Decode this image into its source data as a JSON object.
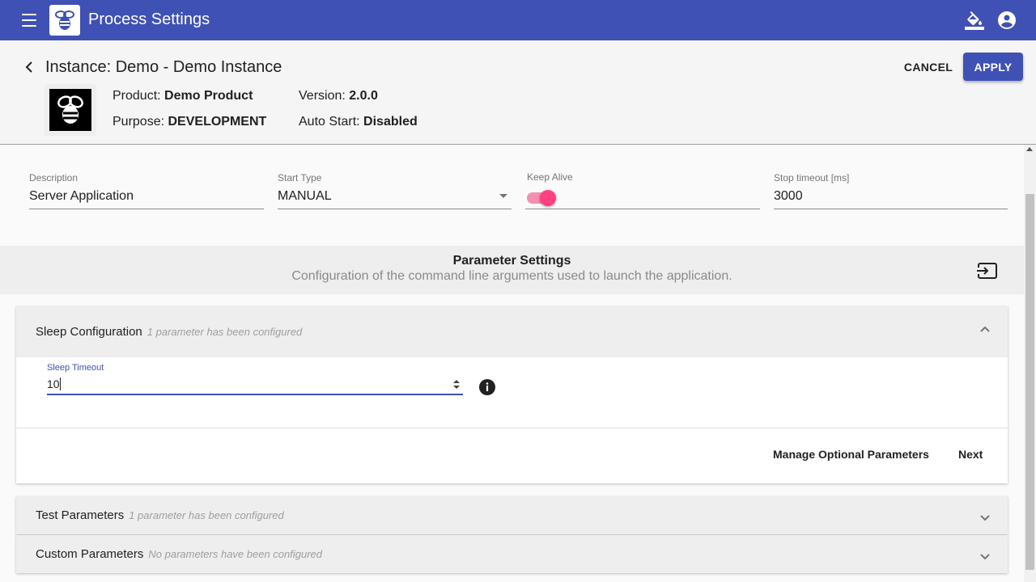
{
  "app": {
    "title": "Process Settings"
  },
  "header": {
    "instance_title": "Instance: Demo - Demo Instance",
    "cancel_label": "CANCEL",
    "apply_label": "APPLY",
    "product_label": "Product:",
    "product_value": "Demo Product",
    "purpose_label": "Purpose:",
    "purpose_value": "DEVELOPMENT",
    "version_label": "Version:",
    "version_value": "2.0.0",
    "autostart_label": "Auto Start:",
    "autostart_value": "Disabled"
  },
  "form": {
    "description_label": "Description",
    "description_value": "Server Application",
    "start_type_label": "Start Type",
    "start_type_value": "MANUAL",
    "keep_alive_label": "Keep Alive",
    "keep_alive_on": true,
    "stop_timeout_label": "Stop timeout [ms]",
    "stop_timeout_value": "3000"
  },
  "parameters": {
    "title": "Parameter Settings",
    "subtitle": "Configuration of the command line arguments used to launch the application.",
    "groups": [
      {
        "name": "Sleep Configuration",
        "note": "1 parameter has been configured",
        "expanded": true
      },
      {
        "name": "Test Parameters",
        "note": "1 parameter has been configured",
        "expanded": false
      },
      {
        "name": "Custom Parameters",
        "note": "No parameters have been configured",
        "expanded": false
      }
    ],
    "sleep_timeout_label": "Sleep Timeout",
    "sleep_timeout_value": "10",
    "manage_label": "Manage Optional Parameters",
    "next_label": "Next"
  },
  "colors": {
    "primary": "#3f51b5",
    "accent": "#ff4081"
  }
}
